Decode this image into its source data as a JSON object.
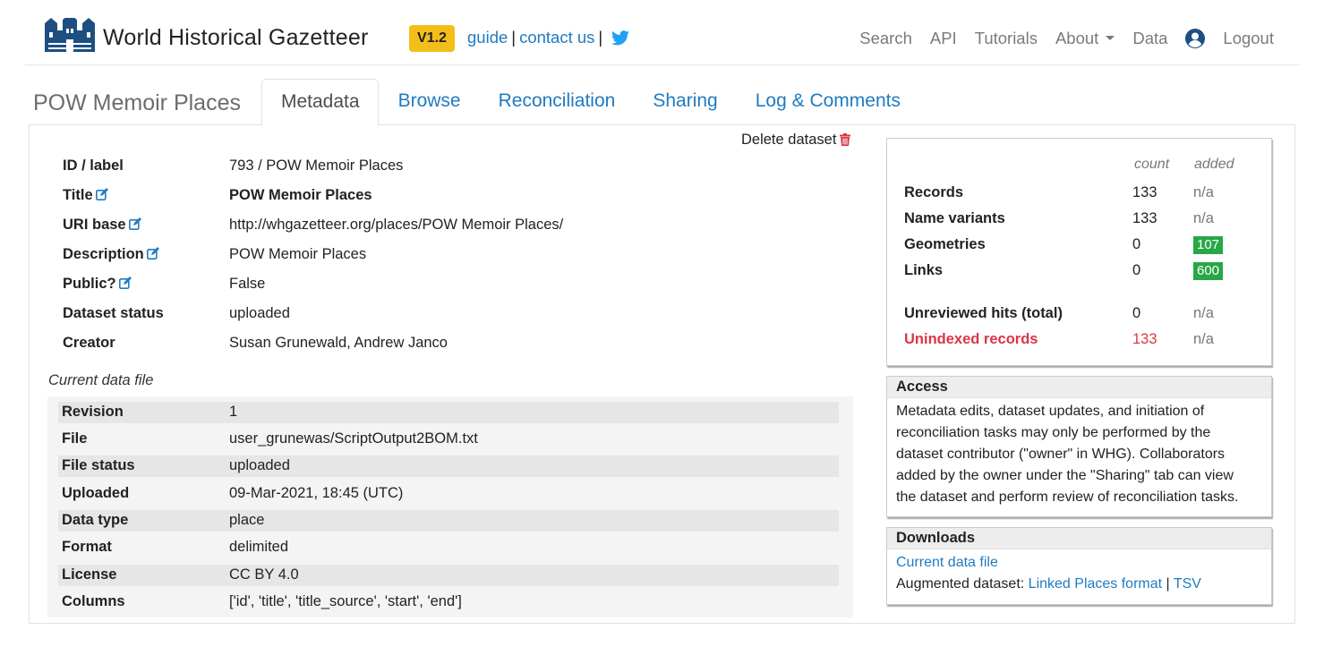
{
  "header": {
    "brand": "World Historical Gazetteer",
    "version": "V1.2",
    "guide": "guide",
    "contact": "contact us",
    "nav": {
      "search": "Search",
      "api": "API",
      "tutorials": "Tutorials",
      "about": "About",
      "data": "Data",
      "logout": "Logout"
    }
  },
  "dataset": {
    "title": "POW Memoir Places",
    "delete": "Delete dataset"
  },
  "tabs": [
    "Metadata",
    "Browse",
    "Reconciliation",
    "Sharing",
    "Log & Comments"
  ],
  "metadata": {
    "id_label": {
      "label": "ID / label",
      "value": "793 / POW Memoir Places"
    },
    "title": {
      "label": "Title",
      "value": "POW Memoir Places"
    },
    "uri_base": {
      "label": "URI base",
      "value": "http://whgazetteer.org/places/POW Memoir Places/"
    },
    "description": {
      "label": "Description",
      "value": "POW Memoir Places"
    },
    "public": {
      "label": "Public?",
      "value": "False"
    },
    "status": {
      "label": "Dataset status",
      "value": "uploaded"
    },
    "creator": {
      "label": "Creator",
      "value": "Susan Grunewald, Andrew Janco"
    }
  },
  "current_file": {
    "heading": "Current data file",
    "rows": [
      {
        "label": "Revision",
        "value": "1"
      },
      {
        "label": "File",
        "value": "user_grunewas/ScriptOutput2BOM.txt"
      },
      {
        "label": "File status",
        "value": "uploaded"
      },
      {
        "label": "Uploaded",
        "value": "09-Mar-2021, 18:45 (UTC)"
      },
      {
        "label": "Data type",
        "value": "place"
      },
      {
        "label": "Format",
        "value": "delimited"
      },
      {
        "label": "License",
        "value": "CC BY 4.0"
      },
      {
        "label": "Columns",
        "value": "['id', 'title', 'title_source', 'start', 'end']"
      }
    ]
  },
  "stats": {
    "count_header": "count",
    "added_header": "added",
    "rows": [
      {
        "label": "Records",
        "count": "133",
        "added": "n/a"
      },
      {
        "label": "Name variants",
        "count": "133",
        "added": "n/a"
      },
      {
        "label": "Geometries",
        "count": "0",
        "added": "107"
      },
      {
        "label": "Links",
        "count": "0",
        "added": "600"
      },
      {
        "label": "Unreviewed hits (total)",
        "count": "0",
        "added": "n/a"
      },
      {
        "label": "Unindexed records",
        "count": "133",
        "added": "n/a"
      }
    ]
  },
  "access": {
    "heading": "Access",
    "lines": [
      "Metadata edits, dataset updates, and initiation of",
      "reconciliation tasks may only be performed by the",
      "dataset contributor (\"owner\" in WHG). Collaborators",
      "added by the owner under the \"Sharing\" tab can view",
      "the dataset and perform review of reconciliation tasks."
    ]
  },
  "downloads": {
    "heading": "Downloads",
    "current_file": "Current data file",
    "augmented_prefix": "Augmented dataset:",
    "linked_places": "Linked Places format",
    "tsv": "TSV"
  },
  "colors": {
    "link": "#1f7bc1",
    "badge_version": "#f4be1a",
    "badge_added": "#28a745",
    "danger": "#dc3545"
  }
}
